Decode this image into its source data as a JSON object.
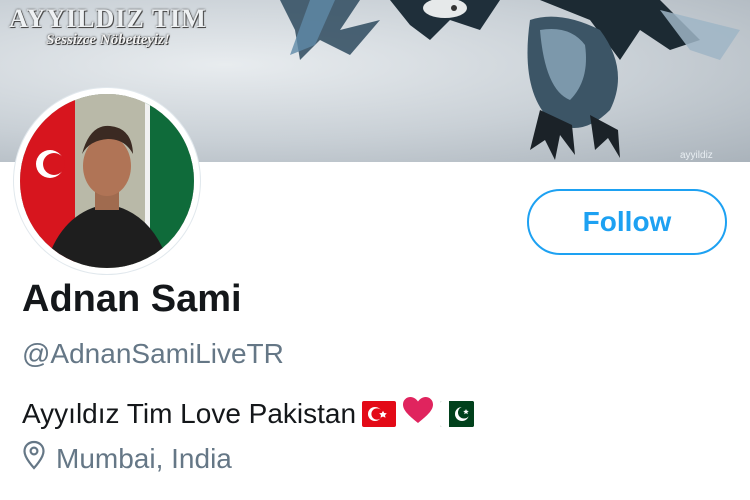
{
  "banner": {
    "title": "AYYILDIZ TIM",
    "subtitle": "Sessizce Nöbetteyiz!",
    "watermark": "ayyildiz"
  },
  "profile": {
    "name": "Adnan Sami",
    "handle": "@AdnanSamiLiveTR",
    "bio_text": "Ayyıldız Tim Love Pakistan",
    "bio_icons": [
      "turkey-flag-icon",
      "red-heart-icon",
      "pakistan-flag-icon"
    ],
    "location": "Mumbai, India",
    "location_icon": "map-pin-icon"
  },
  "actions": {
    "follow_label": "Follow"
  },
  "colors": {
    "accent": "#1da1f2",
    "name_text": "#14171a",
    "secondary_text": "#657786",
    "heart": "#e0245e",
    "turkey_red": "#e30a17",
    "pakistan_green": "#01411c"
  }
}
